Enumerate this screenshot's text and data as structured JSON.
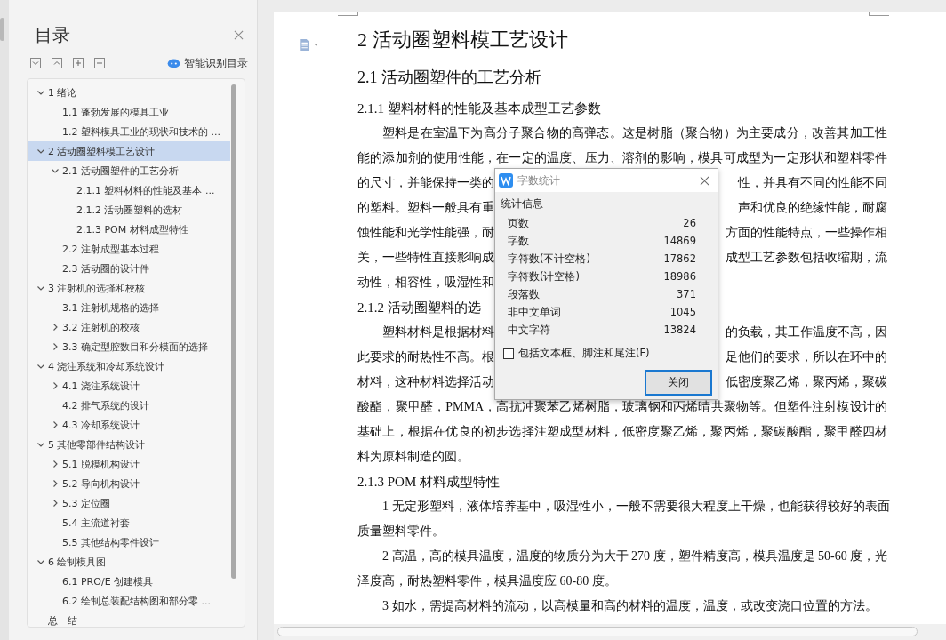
{
  "toc_panel": {
    "title": "目录",
    "smart_button": "智能识别目录",
    "items": [
      {
        "label": "1 绪论",
        "selected": false,
        "expanded": true,
        "children": [
          {
            "label": "1.1 蓬勃发展的模具工业",
            "selected": false
          },
          {
            "label": "1.2 塑料模具工业的现状和技术的 ...",
            "selected": false
          }
        ]
      },
      {
        "label": "2 活动圈塑料模工艺设计",
        "selected": true,
        "expanded": true,
        "children": [
          {
            "label": "2.1 活动圈塑件的工艺分析",
            "selected": false,
            "expanded": true,
            "children": [
              {
                "label": "2.1.1 塑料材料的性能及基本 ...",
                "selected": false
              },
              {
                "label": "2.1.2 活动圈塑料的选材",
                "selected": false
              },
              {
                "label": "2.1.3 POM 材料成型特性",
                "selected": false
              }
            ]
          },
          {
            "label": "2.2 注射成型基本过程",
            "selected": false
          },
          {
            "label": "2.3 活动圈的设计件",
            "selected": false
          }
        ]
      },
      {
        "label": "3 注射机的选择和校核",
        "selected": false,
        "expanded": true,
        "children": [
          {
            "label": "3.1 注射机规格的选择",
            "selected": false
          },
          {
            "label": "3.2 注射机的校核",
            "selected": false,
            "expanded": false
          },
          {
            "label": "3.3 确定型腔数目和分模面的选择",
            "selected": false,
            "expanded": false
          }
        ]
      },
      {
        "label": "4 浇注系统和冷却系统设计",
        "selected": false,
        "expanded": true,
        "children": [
          {
            "label": "4.1 浇注系统设计",
            "selected": false,
            "expanded": false
          },
          {
            "label": "4.2 排气系统的设计",
            "selected": false
          },
          {
            "label": "4.3 冷却系统设计",
            "selected": false,
            "expanded": false
          }
        ]
      },
      {
        "label": "5 其他零部件结构设计",
        "selected": false,
        "expanded": true,
        "children": [
          {
            "label": "5.1 脱模机构设计",
            "selected": false,
            "expanded": false
          },
          {
            "label": "5.2 导向机构设计",
            "selected": false,
            "expanded": false
          },
          {
            "label": "5.3 定位圈",
            "selected": false,
            "expanded": false
          },
          {
            "label": "5.4 主流道衬套",
            "selected": false
          },
          {
            "label": "5.5 其他结构零件设计",
            "selected": false
          }
        ]
      },
      {
        "label": "6 绘制模具图",
        "selected": false,
        "expanded": true,
        "children": [
          {
            "label": "6.1 PRO/E 创建模具",
            "selected": false
          },
          {
            "label": "6.2  绘制总装配结构图和部分零 ...",
            "selected": false
          }
        ]
      },
      {
        "label": "总　结",
        "selected": false
      }
    ]
  },
  "document": {
    "blocks": [
      {
        "kind": "h1",
        "text": "2 活动圈塑料模工艺设计"
      },
      {
        "kind": "h2",
        "text": "2.1 活动圈塑件的工艺分析"
      },
      {
        "kind": "h3",
        "text": "2.1.1 塑料材料的性能及基本成型工艺参数"
      },
      {
        "kind": "line",
        "indent": true,
        "left": "塑料是在室温下为高分子聚合物的高弹态。这是树脂（聚合物）为主要成分，改善其加工性"
      },
      {
        "kind": "line",
        "indent": false,
        "left": "能的添加剂的使用性能，在一定的温度、压力、溶剂的影响，模具可成型为一定形状和塑料零件"
      },
      {
        "kind": "line",
        "indent": false,
        "left": "的尺寸，并能保持一类的",
        "right": "性，并具有不同的性能不同"
      },
      {
        "kind": "line",
        "indent": false,
        "left": "的塑料。塑料一般具有重",
        "right": "声和优良的绝缘性能，耐腐"
      },
      {
        "kind": "line",
        "indent": false,
        "left": "蚀性能和光学性能强，耐",
        "right": "方面的性能特点，一些操作相"
      },
      {
        "kind": "line",
        "indent": false,
        "left": "关，一些特性直接影响成",
        "right": "成型工艺参数包括收缩期，流"
      },
      {
        "kind": "end",
        "indent": false,
        "left": "动性，相容性，吸湿性和"
      },
      {
        "kind": "h3",
        "text": "2.1.2 活动圈塑料的选"
      },
      {
        "kind": "line",
        "indent": true,
        "left": "塑料材料是根据材料",
        "right": "的负载，其工作温度不高，因"
      },
      {
        "kind": "line",
        "indent": false,
        "left": "此要求的耐热性不高。根",
        "right": "足他们的要求，所以在环中的"
      },
      {
        "kind": "line",
        "indent": false,
        "left": "材料，这种材料选择活动",
        "right": "低密度聚乙烯，聚丙烯，聚碳"
      },
      {
        "kind": "line",
        "indent": false,
        "left": "酸酯，聚甲醛，PMMA，高抗冲聚苯乙烯树脂，玻璃钢和丙烯晴共聚物等。但塑件注射模设计的"
      },
      {
        "kind": "line",
        "indent": false,
        "left": "基础上，根据在优良的初步选择注塑成型材料，低密度聚乙烯，聚丙烯，聚碳酸酯，聚甲醛四材"
      },
      {
        "kind": "end",
        "indent": false,
        "left": "料为原料制造的圆。"
      },
      {
        "kind": "h3",
        "text": "2.1.3 POM 材料成型特性"
      },
      {
        "kind": "line",
        "indent": true,
        "left": "1 无定形塑料，液体培养基中，吸湿性小，一般不需要很大程度上干燥，也能获得较好的表面"
      },
      {
        "kind": "end",
        "indent": false,
        "left": "质量塑料零件。"
      },
      {
        "kind": "line",
        "indent": true,
        "left": "2 高温，高的模具温度，温度的物质分为大于 270 度，塑件精度高，模具温度是 50-60 度，光"
      },
      {
        "kind": "end",
        "indent": false,
        "left": "泽度高，耐热塑料零件，模具温度应 60-80 度。"
      },
      {
        "kind": "end",
        "indent": true,
        "left": "3 如水，需提高材料的流动，以高模量和高的材料的温度，温度，或改变浇口位置的方法。"
      }
    ]
  },
  "dialog": {
    "title": "字数统计",
    "group": "统计信息",
    "stats": [
      {
        "label": "页数",
        "value": "26"
      },
      {
        "label": "字数",
        "value": "14869"
      },
      {
        "label": "字符数(不计空格)",
        "value": "17862"
      },
      {
        "label": "字符数(计空格)",
        "value": "18986"
      },
      {
        "label": "段落数",
        "value": "371"
      },
      {
        "label": "非中文单词",
        "value": "1045"
      },
      {
        "label": "中文字符",
        "value": "13824"
      }
    ],
    "checkbox": {
      "label": "包括文本框、脚注和尾注(F)",
      "checked": false
    },
    "button": "关闭"
  }
}
